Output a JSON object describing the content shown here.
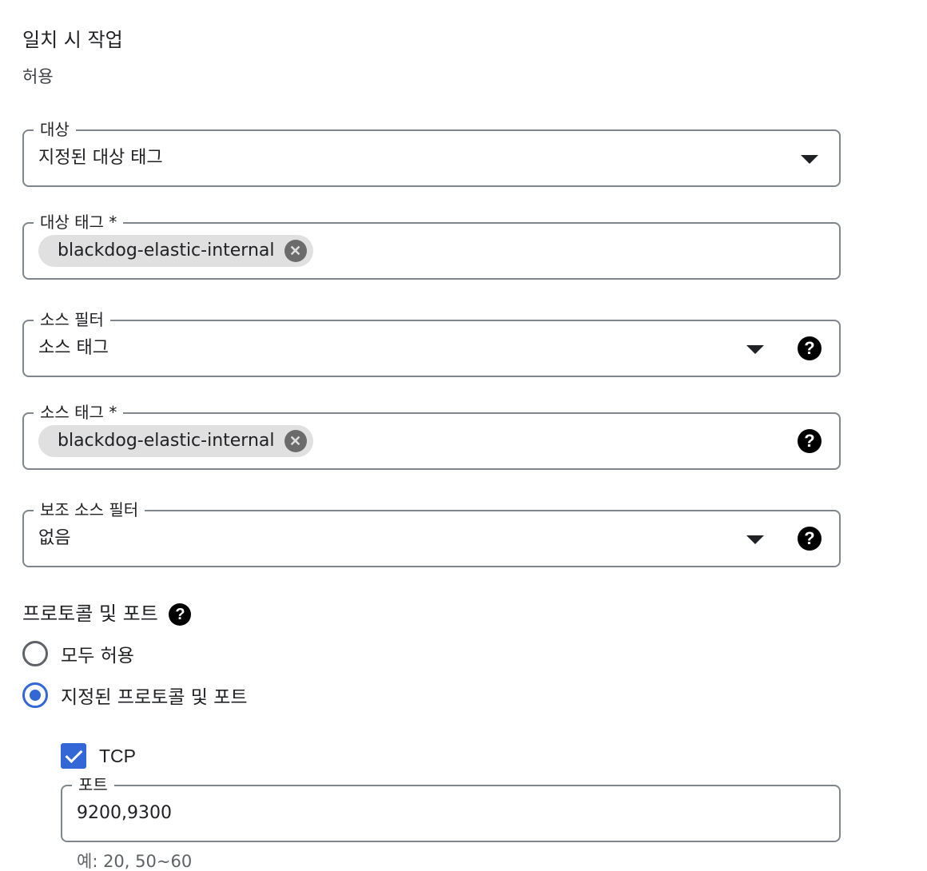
{
  "match_action": {
    "title": "일치 시 작업",
    "value": "허용"
  },
  "target": {
    "label": "대상",
    "value": "지정된 대상 태그"
  },
  "target_tags": {
    "label": "대상 태그 *",
    "chips": [
      "blackdog-elastic-internal"
    ]
  },
  "source_filter": {
    "label": "소스 필터",
    "value": "소스 태그"
  },
  "source_tags": {
    "label": "소스 태그 *",
    "chips": [
      "blackdog-elastic-internal"
    ]
  },
  "secondary_source_filter": {
    "label": "보조 소스 필터",
    "value": "없음"
  },
  "protocols_ports": {
    "title": "프로토콜 및 포트",
    "options": [
      {
        "label": "모두 허용",
        "selected": false
      },
      {
        "label": "지정된 프로토콜 및 포트",
        "selected": true
      }
    ],
    "tcp": {
      "label": "TCP",
      "checked": true,
      "ports_label": "포트",
      "ports_value": "9200,9300",
      "hint": "예: 20, 50~60"
    }
  },
  "icons": {
    "help": "help-icon",
    "dropdown": "dropdown-arrow-icon",
    "chip_remove": "chip-remove-icon",
    "checkmark": "checkmark-icon"
  },
  "colors": {
    "accent": "#3367d6",
    "border": "#80868b",
    "chip_bg": "#e0e0e0"
  }
}
